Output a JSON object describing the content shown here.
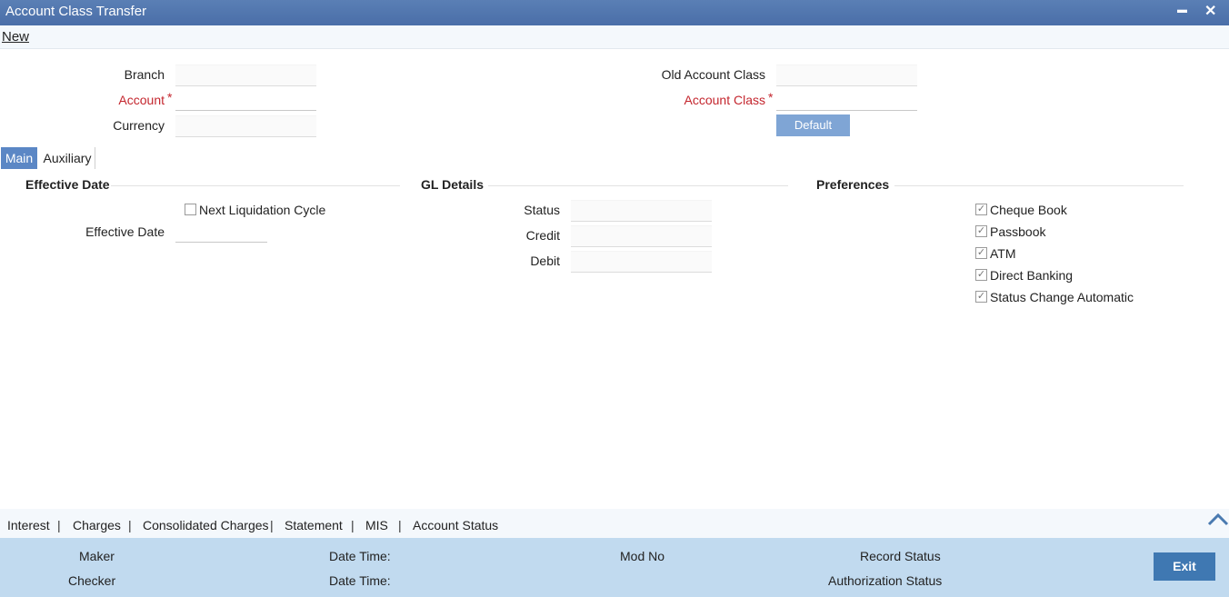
{
  "window": {
    "title": "Account Class Transfer",
    "minimize": "▬",
    "close": "✕"
  },
  "menu": {
    "new": "New"
  },
  "header": {
    "branch": {
      "label": "Branch",
      "value": ""
    },
    "account": {
      "label": "Account",
      "required": "*",
      "value": ""
    },
    "currency": {
      "label": "Currency",
      "value": ""
    },
    "old_account_class": {
      "label": "Old Account Class",
      "value": ""
    },
    "account_class": {
      "label": "Account Class",
      "required": "*",
      "value": ""
    },
    "default_button": "Default"
  },
  "tabs": [
    {
      "label": "Main",
      "active": true
    },
    {
      "label": "Auxiliary",
      "active": false
    }
  ],
  "effective_date_section": {
    "title": "Effective Date",
    "next_liquidation_cycle": {
      "label": "Next Liquidation Cycle",
      "checked": false
    },
    "effective_date": {
      "label": "Effective Date",
      "value": ""
    }
  },
  "gl_details": {
    "title": "GL Details",
    "status": {
      "label": "Status",
      "value": ""
    },
    "credit": {
      "label": "Credit",
      "value": ""
    },
    "debit": {
      "label": "Debit",
      "value": ""
    }
  },
  "preferences": {
    "title": "Preferences",
    "items": [
      {
        "label": "Cheque Book",
        "checked": true
      },
      {
        "label": "Passbook",
        "checked": true
      },
      {
        "label": "ATM",
        "checked": true
      },
      {
        "label": "Direct Banking",
        "checked": true
      },
      {
        "label": "Status Change Automatic",
        "checked": true
      }
    ]
  },
  "bottom_links": [
    "Interest",
    "Charges",
    "Consolidated Charges",
    "Statement",
    "MIS",
    "Account Status"
  ],
  "separator": "|",
  "footer": {
    "maker": "Maker",
    "checker": "Checker",
    "date_time_1": "Date Time:",
    "date_time_2": "Date Time:",
    "mod_no": "Mod No",
    "record_status": "Record Status",
    "authorization_status": "Authorization Status",
    "exit": "Exit"
  },
  "colors": {
    "titlebar": "#4a6ea8",
    "required": "#c4262e",
    "active_tab": "#5b87c5",
    "footer": "#c1daef",
    "exit_button": "#3f78b2"
  }
}
